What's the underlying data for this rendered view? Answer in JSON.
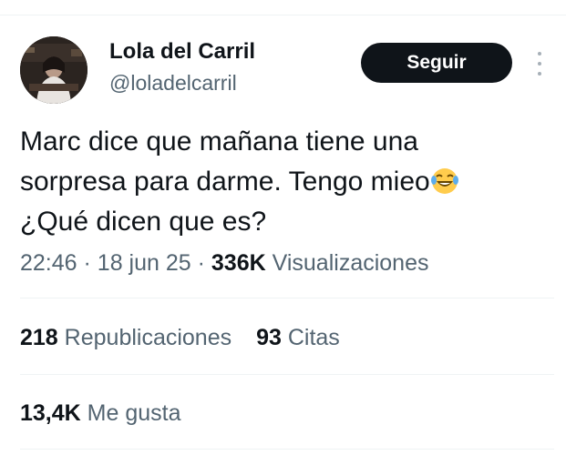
{
  "author": {
    "display_name": "Lola del Carril",
    "handle": "@loladelcarril",
    "avatar_icon": "profile-photo"
  },
  "follow_button": {
    "label": "Seguir"
  },
  "more_menu": {
    "icon": "more-vertical-icon"
  },
  "tweet": {
    "lines": [
      "Marc dice que mañana tiene una",
      "sorpresa para darme. Tengo mieo",
      "¿Qué dicen que es?"
    ],
    "emoji": "face-with-tears-of-joy-icon"
  },
  "meta": {
    "time": "22:46",
    "separator": "·",
    "date": "18 jun 25",
    "views_count": "336K",
    "views_label": "Visualizaciones"
  },
  "stats": {
    "reposts_count": "218",
    "reposts_label": "Republicaciones",
    "quotes_count": "93",
    "quotes_label": "Citas",
    "likes_count": "13,4K",
    "likes_label": "Me gusta"
  },
  "colors": {
    "text": "#0f1419",
    "secondary": "#536471",
    "divider": "#eff3f4",
    "button_bg": "#0f1419"
  }
}
